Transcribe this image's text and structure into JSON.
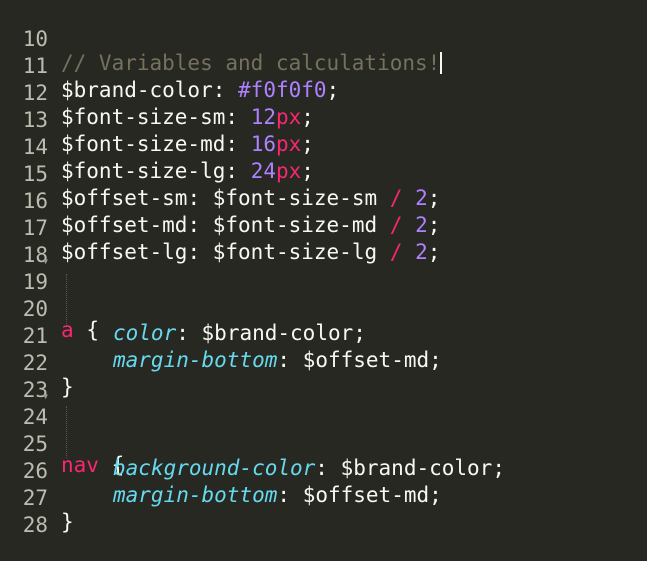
{
  "theme": {
    "background": "#272822",
    "text": "#f8f8f2",
    "comment": "#75715e",
    "number": "#ae81ff",
    "keyword": "#f92672",
    "property": "#66d9ef",
    "gutter": "#bcbcb0"
  },
  "lines": [
    {
      "num": "10",
      "comment": "// Variables and calculations!",
      "cursor_after": true
    },
    {
      "num": "11",
      "var": "$brand-color",
      "colon": ":",
      "value": "#f0f0f0",
      "semi": ";"
    },
    {
      "num": "12",
      "var": "$font-size-sm",
      "colon": ":",
      "num_val": "12",
      "unit": "px",
      "semi": ";"
    },
    {
      "num": "13",
      "var": "$font-size-md",
      "colon": ":",
      "num_val": "16",
      "unit": "px",
      "semi": ";"
    },
    {
      "num": "14",
      "var": "$font-size-lg",
      "colon": ":",
      "num_val": "24",
      "unit": "px",
      "semi": ";"
    },
    {
      "num": "15",
      "var": "$offset-sm",
      "colon": ":",
      "ref": "$font-size-sm",
      "op": "/",
      "num_val": "2",
      "semi": ";"
    },
    {
      "num": "16",
      "var": "$offset-md",
      "colon": ":",
      "ref": "$font-size-md",
      "op": "/",
      "num_val": "2",
      "semi": ";"
    },
    {
      "num": "17",
      "var": "$offset-lg",
      "colon": ":",
      "ref": "$font-size-lg",
      "op": "/",
      "num_val": "2",
      "semi": ";"
    },
    {
      "num": "18"
    },
    {
      "num": "19",
      "selector": "a",
      "brace": "{",
      "fold": "▾"
    },
    {
      "num": "20",
      "prop": "color",
      "colon": ":",
      "ref": "$brand-color",
      "semi": ";"
    },
    {
      "num": "21",
      "prop": "margin-bottom",
      "colon": ":",
      "ref": "$offset-md",
      "semi": ";"
    },
    {
      "num": "22",
      "brace": "}"
    },
    {
      "num": "23"
    },
    {
      "num": "24",
      "selector": "nav",
      "brace": "{",
      "fold": "▾"
    },
    {
      "num": "25",
      "prop": "background-color",
      "colon": ":",
      "ref": "$brand-color",
      "semi": ";"
    },
    {
      "num": "26",
      "prop": "margin-bottom",
      "colon": ":",
      "ref": "$offset-md",
      "semi": ";"
    },
    {
      "num": "27",
      "brace": "}"
    },
    {
      "num": "28"
    }
  ]
}
